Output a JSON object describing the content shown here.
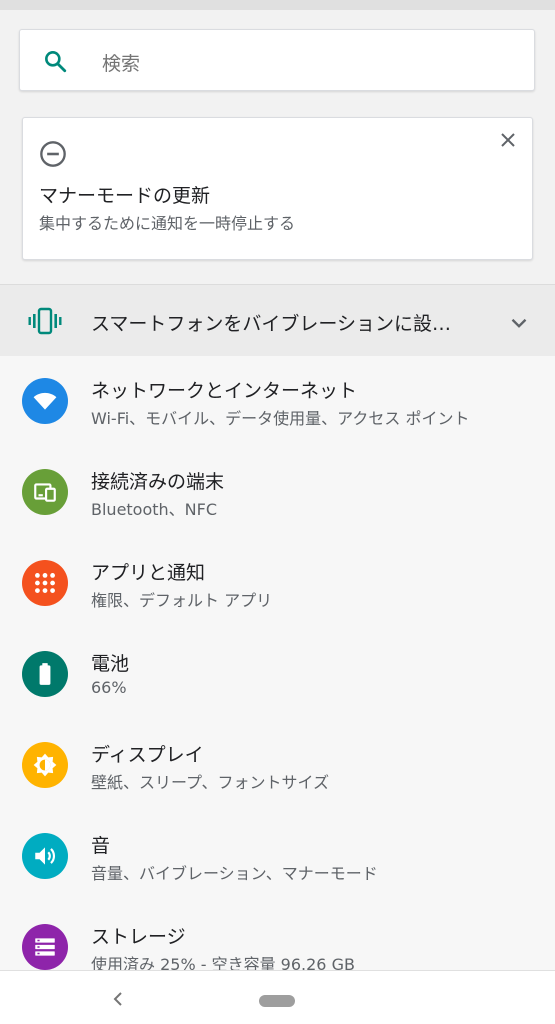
{
  "search": {
    "placeholder": "検索",
    "icon": "search-icon"
  },
  "dnd_card": {
    "title": "マナーモードの更新",
    "subtitle": "集中するために通知を一時停止する",
    "icon": "do-not-disturb-icon",
    "close_icon": "close-icon"
  },
  "vibrate": {
    "label": "スマートフォンをバイブレーションに設…",
    "icon": "vibrate-icon",
    "chevron": "chevron-down-icon"
  },
  "settings": [
    {
      "title": "ネットワークとインターネット",
      "subtitle": "Wi-Fi、モバイル、データ使用量、アクセス ポイント",
      "icon": "wifi-icon",
      "color": "#1e88e5"
    },
    {
      "title": "接続済みの端末",
      "subtitle": "Bluetooth、NFC",
      "icon": "devices-icon",
      "color": "#689f38"
    },
    {
      "title": "アプリと通知",
      "subtitle": "権限、デフォルト アプリ",
      "icon": "apps-icon",
      "color": "#f4511e"
    },
    {
      "title": "電池",
      "subtitle": "66%",
      "icon": "battery-icon",
      "color": "#00796b"
    },
    {
      "title": "ディスプレイ",
      "subtitle": "壁紙、スリープ、フォントサイズ",
      "icon": "brightness-icon",
      "color": "#ffb300"
    },
    {
      "title": "音",
      "subtitle": "音量、バイブレーション、マナーモード",
      "icon": "volume-icon",
      "color": "#00acc1"
    },
    {
      "title": "ストレージ",
      "subtitle": "使用済み 25% - 空き容量 96.26 GB",
      "icon": "storage-icon",
      "color": "#8e24aa"
    }
  ],
  "colors": {
    "accent": "#00897b"
  }
}
